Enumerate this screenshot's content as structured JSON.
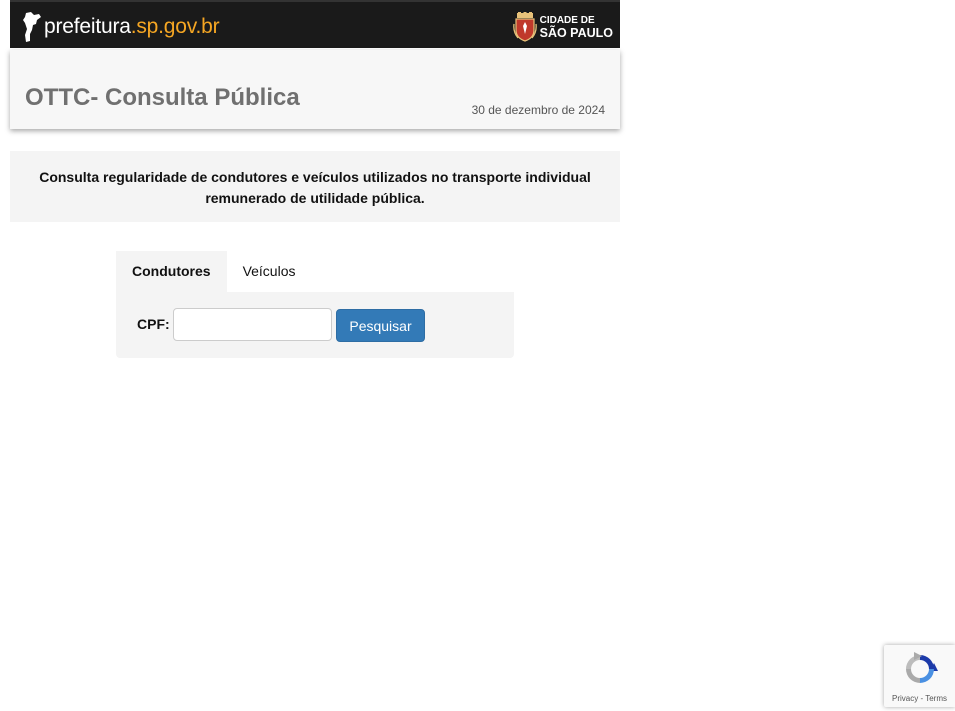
{
  "header": {
    "logo_prefix": "prefeitura",
    "logo_domain": ".sp.gov.br",
    "city_line1": "CIDADE DE",
    "city_line2": "SÃO PAULO"
  },
  "title_card": {
    "title": "OTTC- Consulta Pública",
    "date": "30 de dezembro de 2024"
  },
  "info": {
    "text": "Consulta regularidade de condutores e veículos utilizados no transporte individual remunerado de utilidade pública."
  },
  "tabs": [
    {
      "label": "Condutores",
      "active": true
    },
    {
      "label": "Veículos",
      "active": false
    }
  ],
  "form": {
    "cpf_label": "CPF:",
    "cpf_value": "",
    "search_label": "Pesquisar"
  },
  "recaptcha": {
    "links": "Privacy - Terms"
  },
  "colors": {
    "topbar": "#1a1a1a",
    "logo_accent": "#f5a623",
    "button": "#337ab7"
  }
}
